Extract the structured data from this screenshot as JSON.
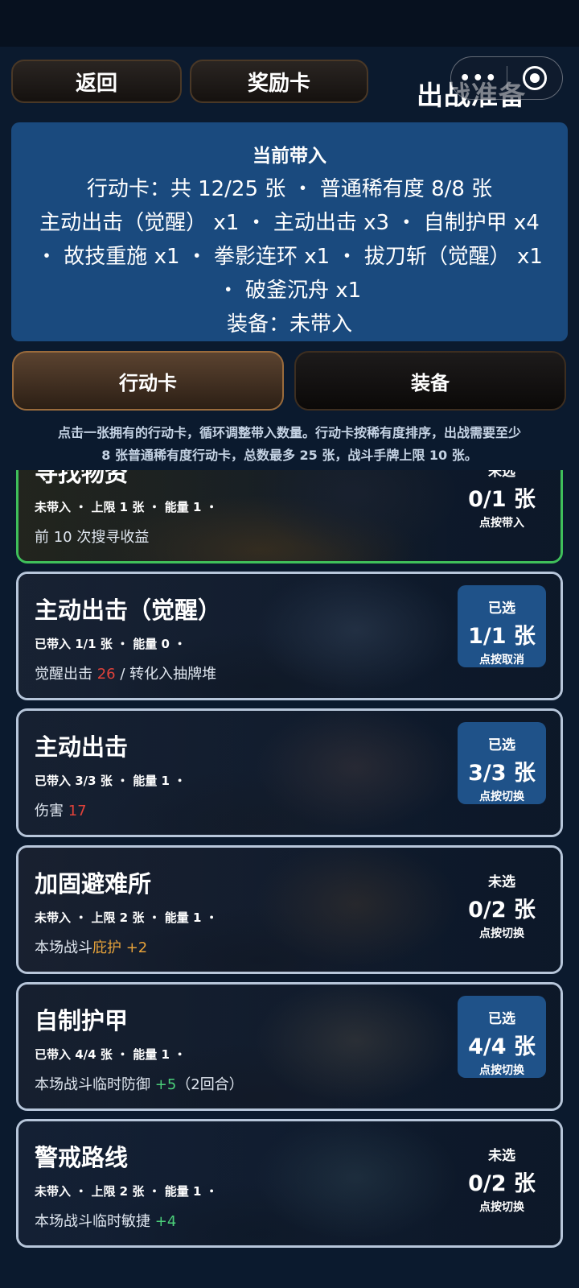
{
  "header": {
    "back_label": "返回",
    "reward_label": "奖励卡",
    "title": "出战准备",
    "capsule_more": "•••"
  },
  "summary": {
    "title": "当前带入",
    "line1": "行动卡：共 12/25 张 ・ 普通稀有度 8/8 张",
    "line2": "主动出击（觉醒） x1 ・ 主动出击 x3 ・ 自制护甲 x4",
    "line3": "・ 故技重施 x1 ・ 拳影连环 x1 ・ 拔刀斩（觉醒） x1",
    "line4": "・ 破釜沉舟 x1",
    "line5": "装备：未带入"
  },
  "tabs": {
    "actions_label": "行动卡",
    "equip_label": "装备",
    "active": "actions"
  },
  "hint": {
    "line1": "点击一张拥有的行动卡，循环调整带入数量。行动卡按稀有度排序，出战需要至少",
    "line2": "8 张普通稀有度行动卡，总数最多 25 张，战斗手牌上限 10 张。"
  },
  "cards": [
    {
      "name": "寻找物资",
      "meta": "未带入 ・ 上限 1 张 ・ 能量 1 ・",
      "desc_prefix": "前 10 次搜寻收益",
      "desc_value": "",
      "desc_suffix": "",
      "state_label": "未选",
      "state_count": "0/1 张",
      "state_hint": "点按带入",
      "selected": false,
      "highlight": "green"
    },
    {
      "name": "主动出击（觉醒）",
      "meta": "已带入 1/1 张 ・ 能量 0 ・",
      "desc_prefix": "觉醒出击 ",
      "desc_value": "26",
      "desc_suffix": " / 转化入抽牌堆",
      "state_label": "已选",
      "state_count": "1/1 张",
      "state_hint": "点按取消",
      "selected": true
    },
    {
      "name": "主动出击",
      "meta": "已带入 3/3 张 ・ 能量 1 ・",
      "desc_prefix": "伤害 ",
      "desc_value": "17",
      "desc_suffix": "",
      "state_label": "已选",
      "state_count": "3/3 张",
      "state_hint": "点按切换",
      "selected": true
    },
    {
      "name": "加固避难所",
      "meta": "未带入 ・ 上限 2 张 ・ 能量 1 ・",
      "desc_prefix": "本场战斗",
      "desc_value": "庇护 +2",
      "desc_suffix": "",
      "state_label": "未选",
      "state_count": "0/2 张",
      "state_hint": "点按切换",
      "selected": false
    },
    {
      "name": "自制护甲",
      "meta": "已带入 4/4 张 ・ 能量 1 ・",
      "desc_prefix": "本场战斗临时防御 ",
      "desc_value": "+5",
      "desc_suffix": "（2回合）",
      "state_label": "已选",
      "state_count": "4/4 张",
      "state_hint": "点按切换",
      "selected": true
    },
    {
      "name": "警戒路线",
      "meta": "未带入 ・ 上限 2 张 ・ 能量 1 ・",
      "desc_prefix": "本场战斗临时敏捷 ",
      "desc_value": "+4",
      "desc_suffix": "",
      "state_label": "未选",
      "state_count": "0/2 张",
      "state_hint": "点按切换",
      "selected": false
    }
  ],
  "colors": {
    "summary_bg": "#1a4a7e",
    "selected_badge": "#1f5289",
    "card_border": "#b7c6da",
    "highlight_border": "#3fbf5a",
    "damage_red": "#e0423a",
    "shelter_orange": "#e6a23a",
    "buff_green": "#4bd07a"
  }
}
